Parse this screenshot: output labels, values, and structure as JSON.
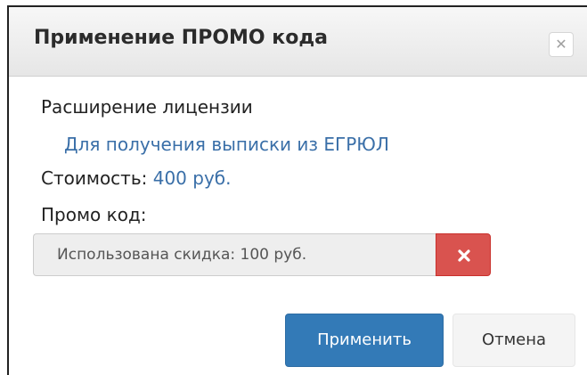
{
  "dialog": {
    "title": "Применение ПРОМО кода",
    "close_icon": "close-icon"
  },
  "license": {
    "title": "Расширение лицензии",
    "subtitle": "Для получения выписки из ЕГРЮЛ",
    "cost_label": "Стоимость:",
    "cost_value": "400 руб."
  },
  "promo": {
    "label": "Промо код:",
    "input_value": "Использована скидка: 100 руб.",
    "remove_icon": "remove-icon",
    "remove_color": "#d9534f"
  },
  "buttons": {
    "apply_label": "Применить",
    "apply_color": "#337ab7",
    "cancel_label": "Отмена"
  }
}
